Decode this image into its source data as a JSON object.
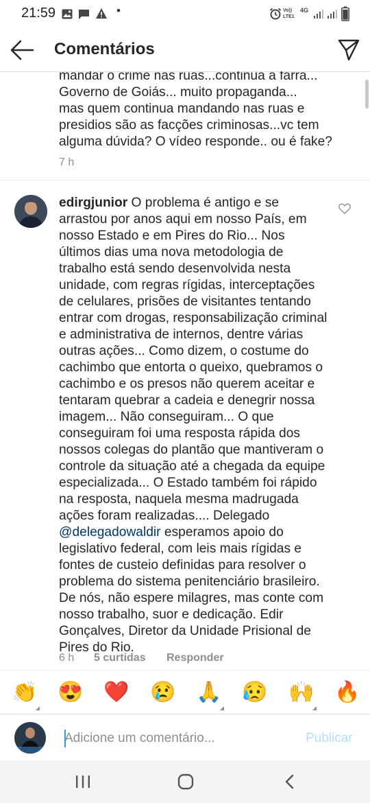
{
  "status_bar": {
    "time": "21:59",
    "network": "4G",
    "carrier": "Vo)) LTE1"
  },
  "header": {
    "title": "Comentários"
  },
  "previous_comment": {
    "lines": [
      "mandar o crime nas ruas...continua a farra...",
      "Governo de Goiás... muito propaganda...",
      "mas quem continua mandando nas ruas e",
      "presidios são as facções criminosas...vc tem",
      "alguma dúvida? O vídeo responde.. ou é fake?"
    ],
    "time": "7 h"
  },
  "comment": {
    "username": "edirgjunior",
    "text_before": " O problema é antigo e se arrastou por anos aqui em nosso País, em nosso Estado e em Pires do Rio... Nos últimos dias uma nova metodologia de trabalho está sendo desenvolvida nesta unidade, com regras rígidas, interceptações de celulares, prisões de visitantes tentando entrar com drogas, responsabilização criminal e administrativa de internos, dentre várias outras ações... Como dizem, o costume do cachimbo que entorta o queixo, quebramos o cachimbo e os presos não querem aceitar e tentaram quebrar a cadeia e denegrir nossa imagem... Não conseguiram... O que conseguiram foi uma resposta rápida dos nossos colegas do plantão que mantiveram o controle da situação até a chegada da equipe especializada... O Estado também foi rápido na resposta, naquela mesma madrugada ações foram realizadas.... Delegado ",
    "mention": "@delegadowaldir",
    "text_after": " esperamos apoio do legislativo federal, com leis mais rígidas e fontes de custeio definidas para resolver o problema do sistema penitenciário brasileiro. De nós, não espere milagres, mas conte com nosso trabalho, suor e dedicação. Edir Gonçalves, Diretor da Unidade Prisional de Pires do Rio.",
    "time": "6 h",
    "likes": "5 curtidas",
    "reply_label": "Responder"
  },
  "emoji_bar": {
    "emojis": [
      "👏",
      "😍",
      "❤️",
      "😢",
      "🙏",
      "😥",
      "🙌",
      "🔥"
    ]
  },
  "composer": {
    "placeholder": "Adicione um comentário...",
    "publish_label": "Publicar",
    "accent_color": "#3897f0"
  },
  "nav_bar": {
    "icons": [
      "recent-apps-icon",
      "home-icon",
      "back-icon"
    ]
  }
}
